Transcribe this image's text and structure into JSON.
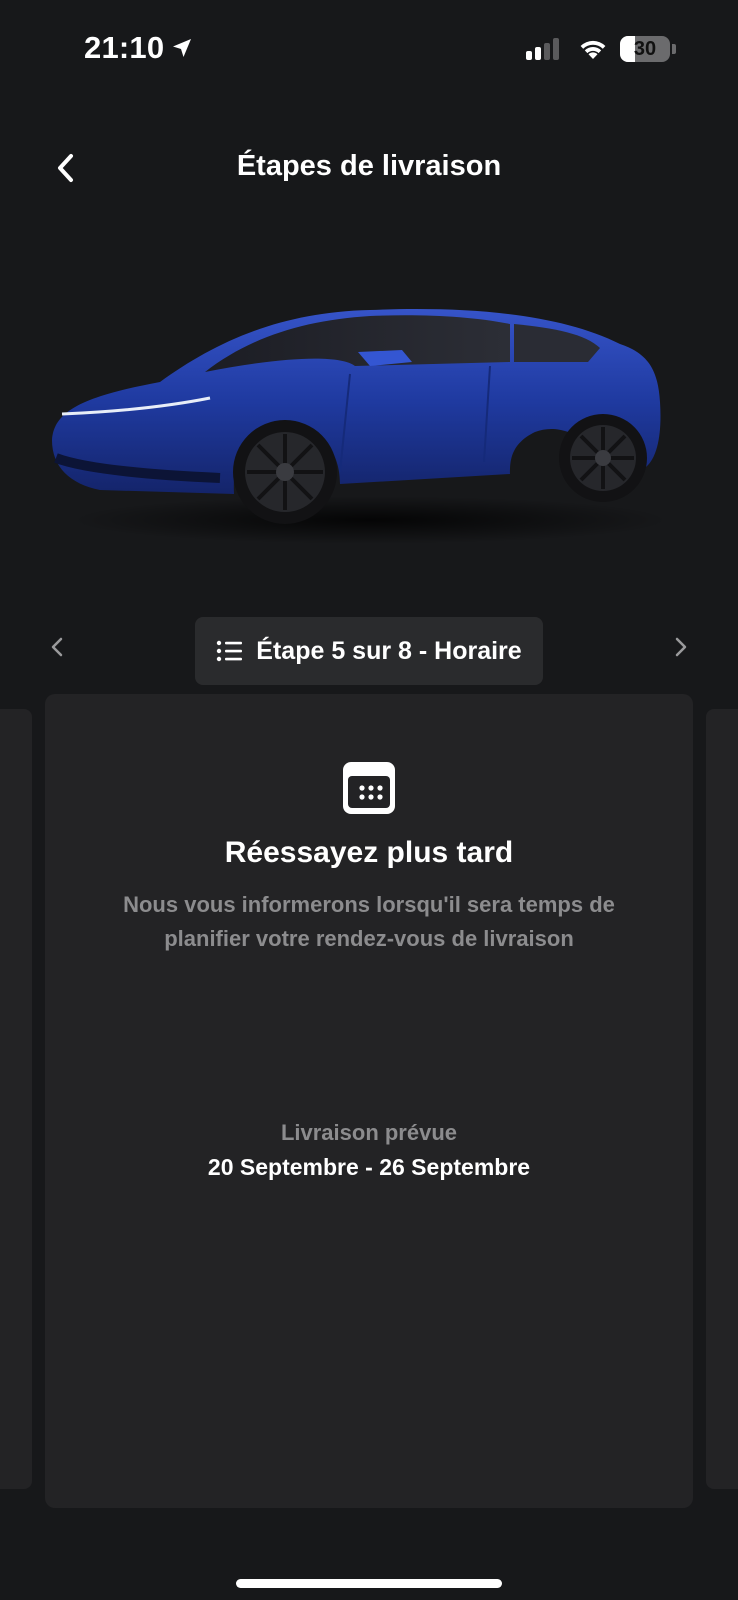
{
  "status_bar": {
    "time": "21:10",
    "battery_level": "30",
    "signal_bars_active": 2,
    "signal_bars_total": 4
  },
  "header": {
    "title": "Étapes de livraison",
    "back_icon": "chevron-left-icon"
  },
  "car": {
    "color": "#1f3fa8"
  },
  "step_nav": {
    "label": "Étape 5 sur 8 - Horaire",
    "list_icon": "list-icon",
    "prev_icon": "chevron-left-icon",
    "next_icon": "chevron-right-icon"
  },
  "card": {
    "icon": "calendar-icon",
    "title": "Réessayez plus tard",
    "message": "Nous vous informerons lorsqu'il sera temps de planifier votre rendez-vous de livraison",
    "delivery_label": "Livraison prévue",
    "delivery_dates": "20 Septembre - 26 Septembre"
  },
  "colors": {
    "background": "#17181a",
    "card": "#232325",
    "pill": "#2a2b2d",
    "muted_text": "#8c8c8e"
  }
}
